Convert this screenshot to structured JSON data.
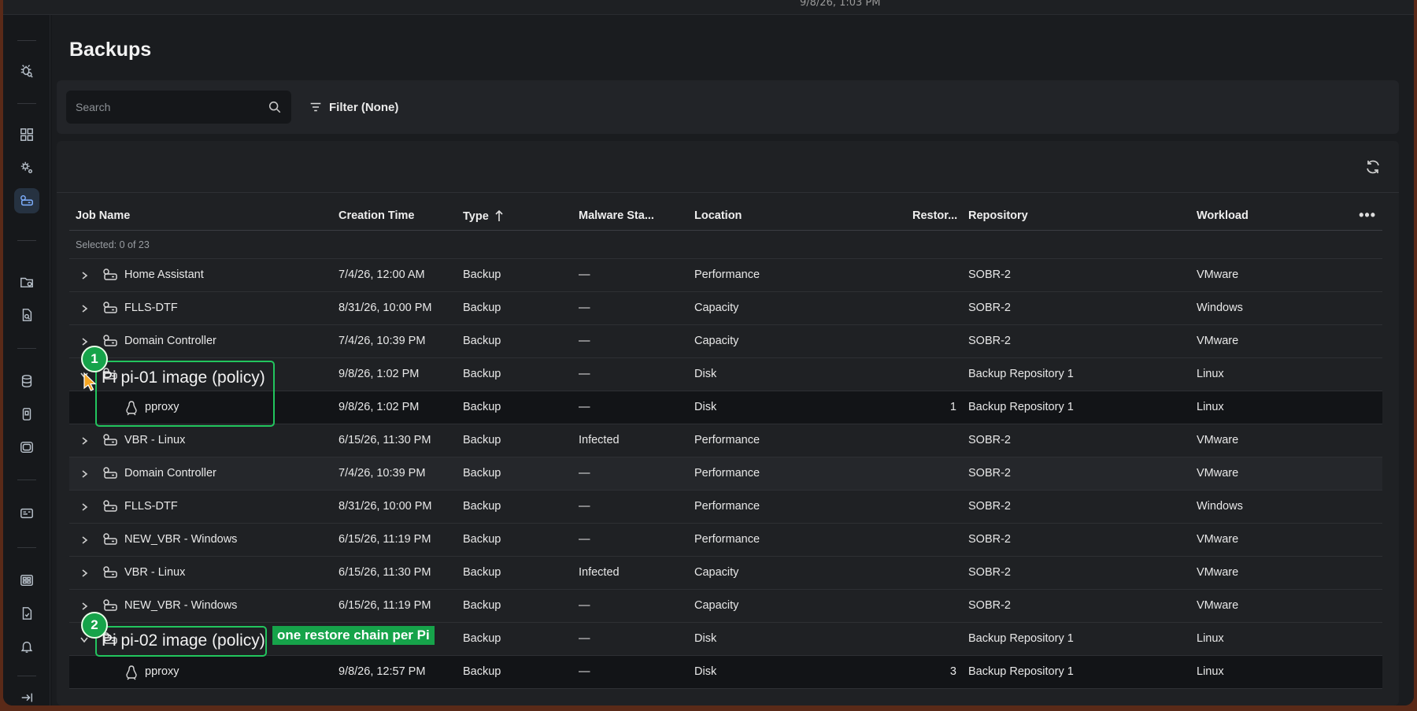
{
  "topbar": {
    "clock": "9/8/26, 1:03 PM"
  },
  "page": {
    "title": "Backups"
  },
  "toolbar": {
    "search_placeholder": "Search",
    "filter_label": "Filter (None)"
  },
  "table": {
    "columns": {
      "job_name": "Job Name",
      "creation_time": "Creation Time",
      "type": "Type",
      "malware": "Malware Sta...",
      "location": "Location",
      "restore": "Restor...",
      "repository": "Repository",
      "workload": "Workload"
    },
    "selected_text": "Selected: 0 of 23",
    "rows": [
      {
        "name": "Home Assistant",
        "time": "7/4/26, 12:00 AM",
        "type": "Backup",
        "malware": "—",
        "location": "Performance",
        "restore": "",
        "repository": "SOBR-2",
        "workload": "VMware"
      },
      {
        "name": "FLLS-DTF",
        "time": "8/31/26, 10:00 PM",
        "type": "Backup",
        "malware": "—",
        "location": "Capacity",
        "restore": "",
        "repository": "SOBR-2",
        "workload": "Windows"
      },
      {
        "name": "Domain Controller",
        "time": "7/4/26, 10:39 PM",
        "type": "Backup",
        "malware": "—",
        "location": "Capacity",
        "restore": "",
        "repository": "SOBR-2",
        "workload": "VMware"
      },
      {
        "name": "",
        "time": "9/8/26, 1:02 PM",
        "type": "Backup",
        "malware": "—",
        "location": "Disk",
        "restore": "",
        "repository": "Backup Repository 1",
        "workload": "Linux"
      },
      {
        "name": "pproxy",
        "time": "9/8/26, 1:02 PM",
        "type": "Backup",
        "malware": "—",
        "location": "Disk",
        "restore": "1",
        "repository": "Backup Repository 1",
        "workload": "Linux"
      },
      {
        "name": "VBR - Linux",
        "time": "6/15/26, 11:30 PM",
        "type": "Backup",
        "malware": "Infected",
        "location": "Performance",
        "restore": "",
        "repository": "SOBR-2",
        "workload": "VMware"
      },
      {
        "name": "Domain Controller",
        "time": "7/4/26, 10:39 PM",
        "type": "Backup",
        "malware": "—",
        "location": "Performance",
        "restore": "",
        "repository": "SOBR-2",
        "workload": "VMware"
      },
      {
        "name": "FLLS-DTF",
        "time": "8/31/26, 10:00 PM",
        "type": "Backup",
        "malware": "—",
        "location": "Performance",
        "restore": "",
        "repository": "SOBR-2",
        "workload": "Windows"
      },
      {
        "name": "NEW_VBR - Windows",
        "time": "6/15/26, 11:19 PM",
        "type": "Backup",
        "malware": "—",
        "location": "Performance",
        "restore": "",
        "repository": "SOBR-2",
        "workload": "VMware"
      },
      {
        "name": "VBR - Linux",
        "time": "6/15/26, 11:30 PM",
        "type": "Backup",
        "malware": "Infected",
        "location": "Capacity",
        "restore": "",
        "repository": "SOBR-2",
        "workload": "VMware"
      },
      {
        "name": "NEW_VBR - Windows",
        "time": "6/15/26, 11:19 PM",
        "type": "Backup",
        "malware": "—",
        "location": "Capacity",
        "restore": "",
        "repository": "SOBR-2",
        "workload": "VMware"
      },
      {
        "name": "",
        "time": "",
        "type": "Backup",
        "malware": "—",
        "location": "Disk",
        "restore": "",
        "repository": "Backup Repository 1",
        "workload": "Linux"
      },
      {
        "name": "pproxy",
        "time": "9/8/26, 12:57 PM",
        "type": "Backup",
        "malware": "—",
        "location": "Disk",
        "restore": "3",
        "repository": "Backup Repository 1",
        "workload": "Linux"
      }
    ]
  },
  "annotations": {
    "callout1": {
      "number": "1",
      "label": "Pi pi-01 image (policy)"
    },
    "callout2": {
      "number": "2",
      "label": "Pi pi-02 image (policy)"
    },
    "note": "one restore chain per Pi"
  },
  "icons": {
    "sidebar": [
      "bug-scan-icon",
      "dashboard-icon",
      "settings-cog-icon",
      "backups-icon",
      "folder-restore-icon",
      "file-search-icon",
      "database-icon",
      "mobile-icon",
      "tape-icon",
      "report-icon",
      "grid-icon",
      "file-check-icon",
      "bell-icon",
      "collapse-icon"
    ],
    "active": "backups-icon"
  }
}
